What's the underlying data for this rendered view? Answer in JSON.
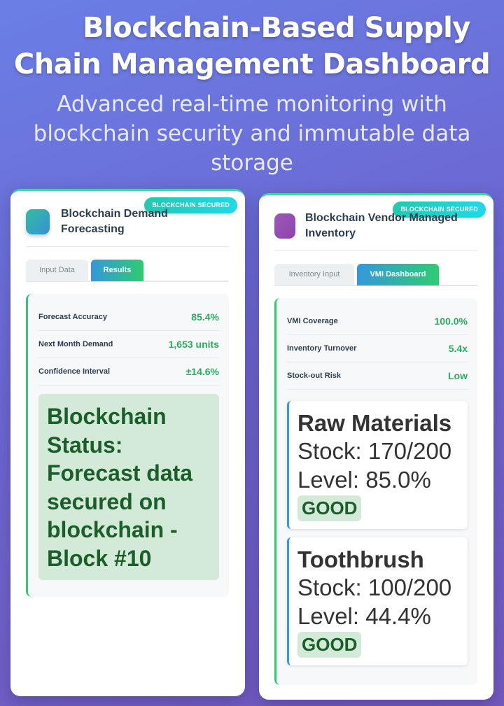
{
  "page": {
    "title_line1": "Blockchain-Based Supply",
    "title_line2": "Chain Management Dashboard",
    "subtitle": "Advanced real-time monitoring with blockchain security and immutable data storage"
  },
  "colors": {
    "accent_green": "#27ae60",
    "badge_teal": "#22d8e6",
    "status_bg": "#d4ead8",
    "tab_active_start": "#3498db",
    "tab_active_end": "#2ecc71"
  },
  "forecast_card": {
    "badge": "BLOCKCHAIN SECURED",
    "title": "Blockchain Demand Forecasting",
    "icon": "forecast-icon",
    "tabs": [
      {
        "label": "Input Data",
        "active": false
      },
      {
        "label": "Results",
        "active": true
      }
    ],
    "metrics": [
      {
        "label": "Forecast Accuracy",
        "value": "85.4%"
      },
      {
        "label": "Next Month Demand",
        "value": "1,653 units"
      },
      {
        "label": "Confidence Interval",
        "value": "±14.6%"
      }
    ],
    "status": "Blockchain Status: Forecast data secured on blockchain - Block #10"
  },
  "vmi_card": {
    "badge": "BLOCKCHAIN SECURED",
    "title": "Blockchain Vendor Managed Inventory",
    "icon": "inventory-icon",
    "tabs": [
      {
        "label": "Inventory Input",
        "active": false
      },
      {
        "label": "VMI Dashboard",
        "active": true
      }
    ],
    "metrics": [
      {
        "label": "VMI Coverage",
        "value": "100.0%"
      },
      {
        "label": "Inventory Turnover",
        "value": "5.4x"
      },
      {
        "label": "Stock-out Risk",
        "value": "Low"
      }
    ],
    "items": [
      {
        "name": "Raw Materials",
        "stock": "Stock: 170/200",
        "level": "Level: 85.0%",
        "status": "GOOD"
      },
      {
        "name": "Toothbrush",
        "stock": "Stock: 100/200",
        "level": "Level: 44.4%",
        "status": "GOOD"
      }
    ]
  }
}
